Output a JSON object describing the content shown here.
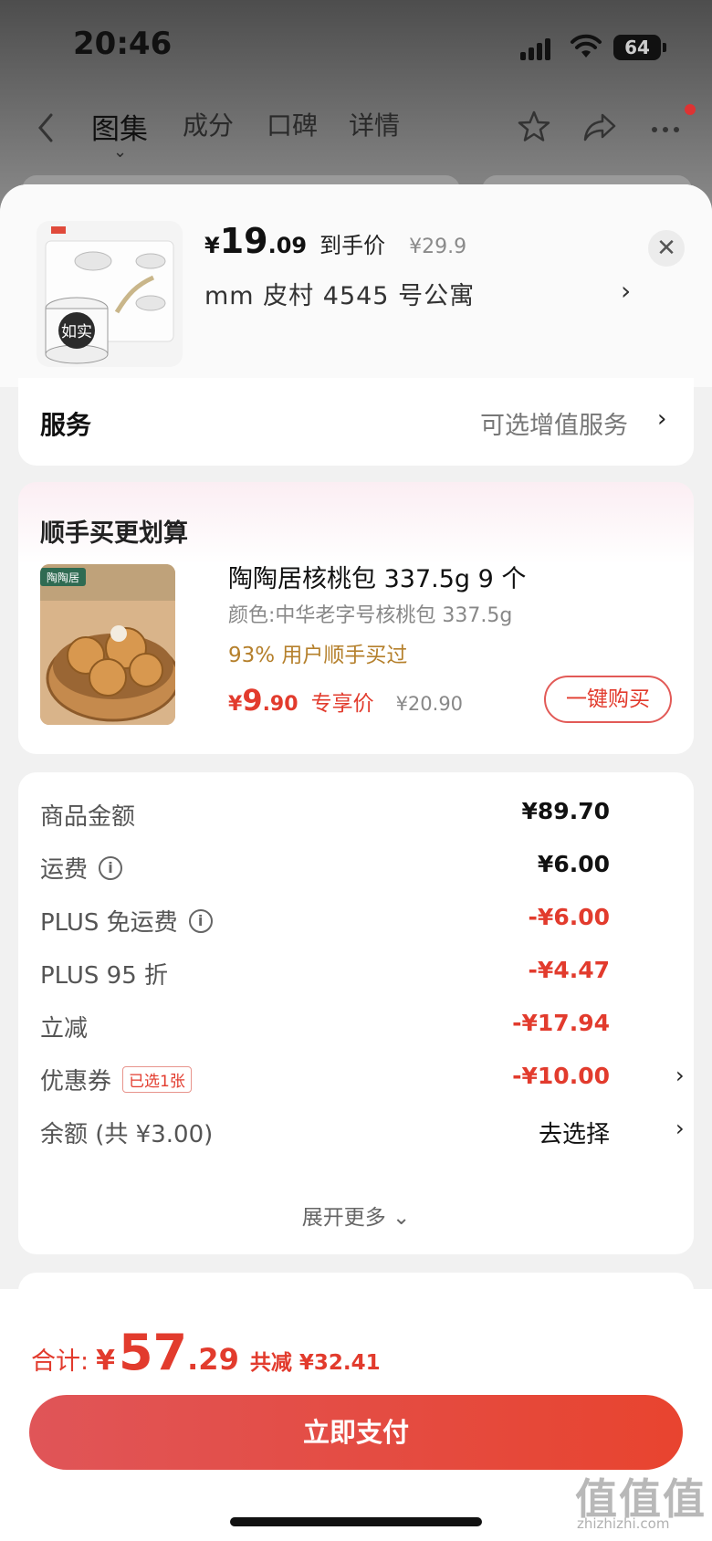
{
  "status_bar": {
    "time": "20:46",
    "battery": "64"
  },
  "nav": {
    "tabs": [
      "图集",
      "成分",
      "口碑",
      "详情"
    ],
    "indicator": "⌄"
  },
  "sheet": {
    "product": {
      "price_symbol": "¥",
      "price_int": "19",
      "price_dec": ".09",
      "price_label": "到手价",
      "original_price": "¥29.9",
      "address": "mm  皮村 4545 号公寓",
      "thumb_brand": "如实"
    },
    "service": {
      "title": "服务",
      "value": "可选增值服务"
    },
    "addon": {
      "section_title": "顺手买更划算",
      "image_brand": "陶陶居",
      "name": "陶陶居核桃包 337.5g 9 个",
      "spec": "颜色:中华老字号核桃包 337.5g",
      "rate": "93% 用户顺手买过",
      "price_symbol": "¥",
      "price_int": "9",
      "price_dec": ".90",
      "price_label": "专享价",
      "original_price": "¥20.90",
      "buy_label": "一键购买"
    },
    "fees": [
      {
        "label": "商品金额",
        "amount": "¥89.70",
        "red": false,
        "info": false,
        "tag": "",
        "chevron": false
      },
      {
        "label": "运费",
        "amount": "¥6.00",
        "red": false,
        "info": true,
        "tag": "",
        "chevron": false
      },
      {
        "label": "PLUS 免运费",
        "amount": "-¥6.00",
        "red": true,
        "info": true,
        "tag": "",
        "chevron": false
      },
      {
        "label": "PLUS 95 折",
        "amount": "-¥4.47",
        "red": true,
        "info": false,
        "tag": "",
        "chevron": false
      },
      {
        "label": "立减",
        "amount": "-¥17.94",
        "red": true,
        "info": false,
        "tag": "",
        "chevron": false
      },
      {
        "label": "优惠券",
        "amount": "-¥10.00",
        "red": true,
        "info": false,
        "tag": "已选1张",
        "chevron": true
      },
      {
        "label": "余额 (共 ¥3.00)",
        "amount": "去选择",
        "red": false,
        "info": false,
        "tag": "",
        "chevron": true
      }
    ],
    "expand_label": "展开更多 ⌄"
  },
  "bottom": {
    "total_label": "合计:",
    "total_symbol": "¥",
    "total_int": "57",
    "total_dec": ".29",
    "total_saved": "共减 ¥32.41",
    "pay_label": "立即支付"
  },
  "watermark": {
    "main": "值值值",
    "sub": "zhizhizhi.com"
  },
  "colors": {
    "accent_red": "#e23b2d",
    "pay_gradient_start": "#e05558",
    "pay_gradient_end": "#e8442f",
    "rate_gold": "#b5802c"
  }
}
